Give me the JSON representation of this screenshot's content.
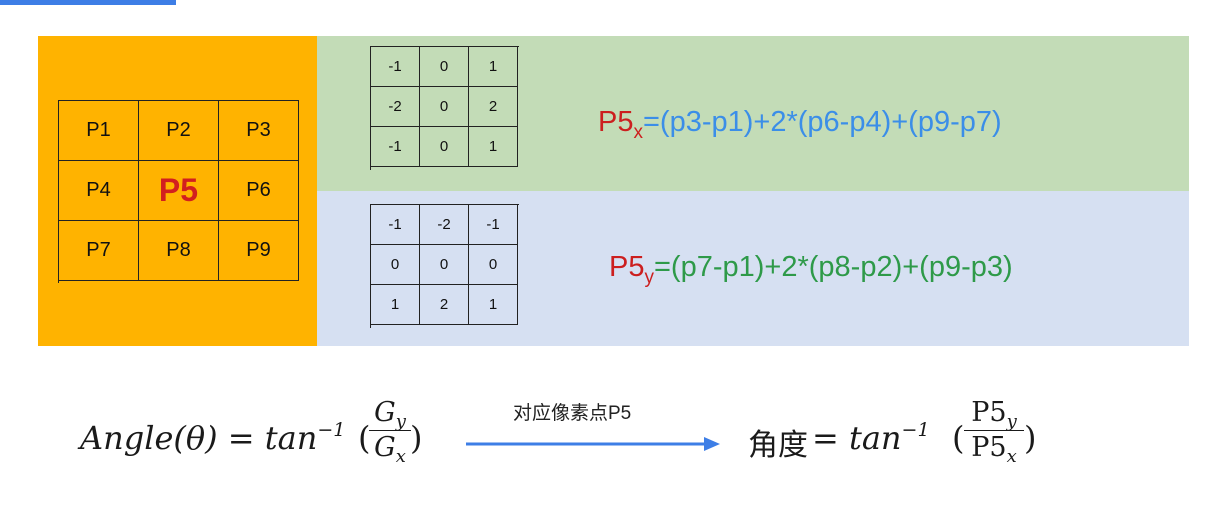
{
  "pixel_grid": {
    "cells": [
      "P1",
      "P2",
      "P3",
      "P4",
      "P5",
      "P6",
      "P7",
      "P8",
      "P9"
    ],
    "center_color": "#d21f1f"
  },
  "kernel_x": [
    "-1",
    "0",
    "1",
    "-2",
    "0",
    "2",
    "-1",
    "0",
    "1"
  ],
  "kernel_y": [
    "-1",
    "-2",
    "-1",
    "0",
    "0",
    "0",
    "1",
    "2",
    "1"
  ],
  "formula_x": {
    "lhs": "P5",
    "subscript": "x",
    "rhs": "=(p3-p1)+2*(p6-p4)+(p9-p7)"
  },
  "formula_y": {
    "lhs": "P5",
    "subscript": "y",
    "rhs": "=(p7-p1)+2*(p8-p2)+(p9-p3)"
  },
  "angle_formula": {
    "lhs": "Angle(θ) = tan",
    "exponent": "−1",
    "numerator": "G",
    "numerator_sub": "y",
    "denominator": "G",
    "denominator_sub": "x"
  },
  "arrow_label": "对应像素点P5",
  "angle_cn_formula": {
    "lhs": "角度",
    "eq": " = tan",
    "exponent": "−1",
    "numerator": "P5",
    "numerator_sub": "y",
    "denominator": "P5",
    "denominator_sub": "x"
  },
  "colors": {
    "pixel_panel": "#ffb300",
    "band_x": "#c3dcb7",
    "band_y": "#d6e0f2",
    "formula_x_text": "#3b8ee8",
    "formula_y_text": "#2e9a49",
    "arrow": "#3d7ee6"
  }
}
